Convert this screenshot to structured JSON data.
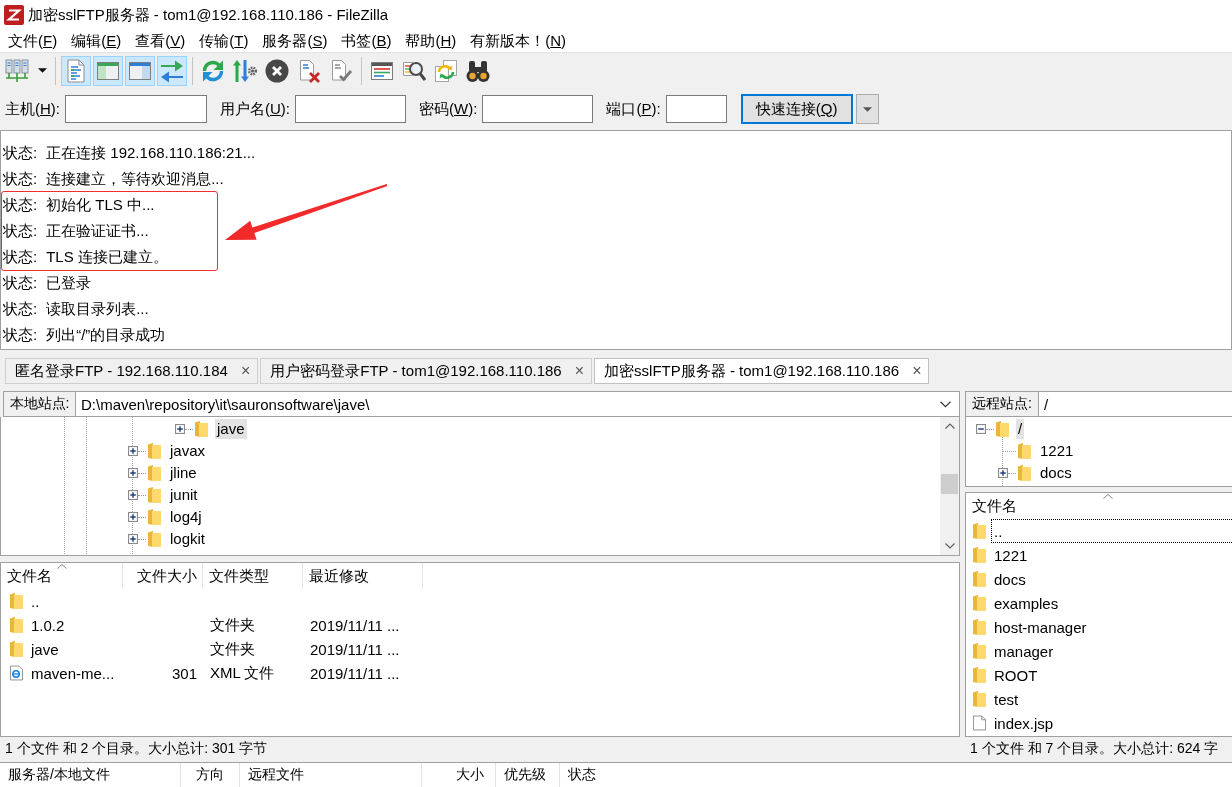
{
  "window": {
    "title": "加密sslFTP服务器 - tom1@192.168.110.186 - FileZilla"
  },
  "menu": [
    {
      "pre": "文件(",
      "key": "F",
      "post": ")"
    },
    {
      "pre": "编辑(",
      "key": "E",
      "post": ")"
    },
    {
      "pre": "查看(",
      "key": "V",
      "post": ")"
    },
    {
      "pre": "传输(",
      "key": "T",
      "post": ")"
    },
    {
      "pre": "服务器(",
      "key": "S",
      "post": ")"
    },
    {
      "pre": "书签(",
      "key": "B",
      "post": ")"
    },
    {
      "pre": "帮助(",
      "key": "H",
      "post": ")"
    },
    {
      "pre": "有新版本！(",
      "key": "N",
      "post": ")"
    }
  ],
  "toolbar": [
    [
      {
        "on": false,
        "dropdown": true
      }
    ],
    [
      {
        "on": true
      },
      {
        "on": true
      },
      {
        "on": true
      },
      {
        "on": true
      }
    ],
    [
      {
        "on": false
      },
      {
        "on": false
      },
      {
        "on": false
      },
      {
        "on": false
      },
      {
        "on": false
      }
    ],
    [
      {
        "on": false
      },
      {
        "on": false
      },
      {
        "on": false
      },
      {
        "on": false
      }
    ]
  ],
  "quickconnect": {
    "fields": [
      {
        "pre": "主机(",
        "key": "H",
        "post": "):"
      },
      {
        "pre": "用户名(",
        "key": "U",
        "post": "):"
      },
      {
        "pre": "密码(",
        "key": "W",
        "post": "):"
      },
      {
        "pre": "端口(",
        "key": "P",
        "post": "):"
      }
    ],
    "button": {
      "pre": "快速连接(",
      "key": "Q",
      "post": ")"
    }
  },
  "log": [
    {
      "label": "状态:",
      "text": "正在连接 192.168.110.186:21...",
      "marked": false
    },
    {
      "label": "状态:",
      "text": "连接建立，等待欢迎消息...",
      "marked": false
    },
    {
      "label": "状态:",
      "text": "初始化 TLS 中...",
      "marked": true
    },
    {
      "label": "状态:",
      "text": "正在验证证书...",
      "marked": true
    },
    {
      "label": "状态:",
      "text": "TLS 连接已建立。",
      "marked": true
    },
    {
      "label": "状态:",
      "text": "已登录",
      "marked": false
    },
    {
      "label": "状态:",
      "text": "读取目录列表...",
      "marked": false
    },
    {
      "label": "状态:",
      "text": "列出“/”的目录成功",
      "marked": false
    }
  ],
  "tabs": [
    {
      "title": "匿名登录FTP - 192.168.110.184",
      "close": "×",
      "selected": false
    },
    {
      "title": "用户密码登录FTP - tom1@192.168.110.186",
      "close": "×",
      "selected": false
    },
    {
      "title": "加密sslFTP服务器 - tom1@192.168.110.186",
      "close": "×",
      "selected": true
    }
  ],
  "local": {
    "site": {
      "label": "本地站点:",
      "path": "D:\\maven\\repository\\it\\sauronsoftware\\jave\\"
    },
    "tree": [
      {
        "children": [
          {
            "children": [
              {
                "name": "jave",
                "expanded": false,
                "selected": true
              }
            ]
          }
        ]
      },
      {
        "name": "javax",
        "expanded": false,
        "selected": false
      },
      {
        "name": "jline",
        "expanded": false,
        "selected": false
      },
      {
        "name": "junit",
        "expanded": false,
        "selected": false
      },
      {
        "name": "log4j",
        "expanded": false,
        "selected": false
      },
      {
        "name": "logkit",
        "expanded": false,
        "selected": false
      }
    ],
    "columns": [
      {
        "title": "文件名",
        "sorted": true
      },
      {
        "title": "文件大小",
        "sorted": false
      },
      {
        "title": "文件类型",
        "sorted": false
      },
      {
        "title": "最近修改",
        "sorted": false
      }
    ],
    "rows": [
      {
        "kind": "folder",
        "name": ".."
      },
      {
        "kind": "folder",
        "name": "1.0.2",
        "type": "文件夹",
        "modified": "2019/11/11 ..."
      },
      {
        "kind": "folder",
        "name": "jave",
        "type": "文件夹",
        "modified": "2019/11/11 ..."
      },
      {
        "kind": "web_document",
        "name": "maven-me...",
        "size": "301",
        "type": "XML 文件",
        "modified": "2019/11/11 ..."
      }
    ],
    "status": "1 个文件 和 2 个目录。大小总计: 301 字节"
  },
  "remote": {
    "site": {
      "label": "远程站点:",
      "path": "/"
    },
    "tree": [
      {
        "name": "/",
        "expanded": true,
        "selected": true,
        "children": [
          {
            "name": "1221",
            "selected": false
          },
          {
            "name": "docs",
            "expanded": false,
            "selected": false
          }
        ]
      }
    ],
    "columns": [
      {
        "title": "文件名",
        "sorted": true
      }
    ],
    "rows": [
      {
        "kind": "folder",
        "name": "..",
        "focused": true
      },
      {
        "kind": "folder",
        "name": "1221",
        "focused": false
      },
      {
        "kind": "folder",
        "name": "docs",
        "focused": false
      },
      {
        "kind": "folder",
        "name": "examples",
        "focused": false
      },
      {
        "kind": "folder",
        "name": "host-manager",
        "focused": false
      },
      {
        "kind": "folder",
        "name": "manager",
        "focused": false
      },
      {
        "kind": "folder",
        "name": "ROOT",
        "focused": false
      },
      {
        "kind": "folder",
        "name": "test",
        "focused": false
      },
      {
        "kind": "document",
        "name": "index.jsp",
        "focused": false
      }
    ],
    "status": "1 个文件 和 7 个目录。大小总计: 624 字"
  },
  "queue": {
    "columns": [
      "服务器/本地文件",
      "方向",
      "远程文件",
      "大小",
      "优先级",
      "状态"
    ]
  }
}
